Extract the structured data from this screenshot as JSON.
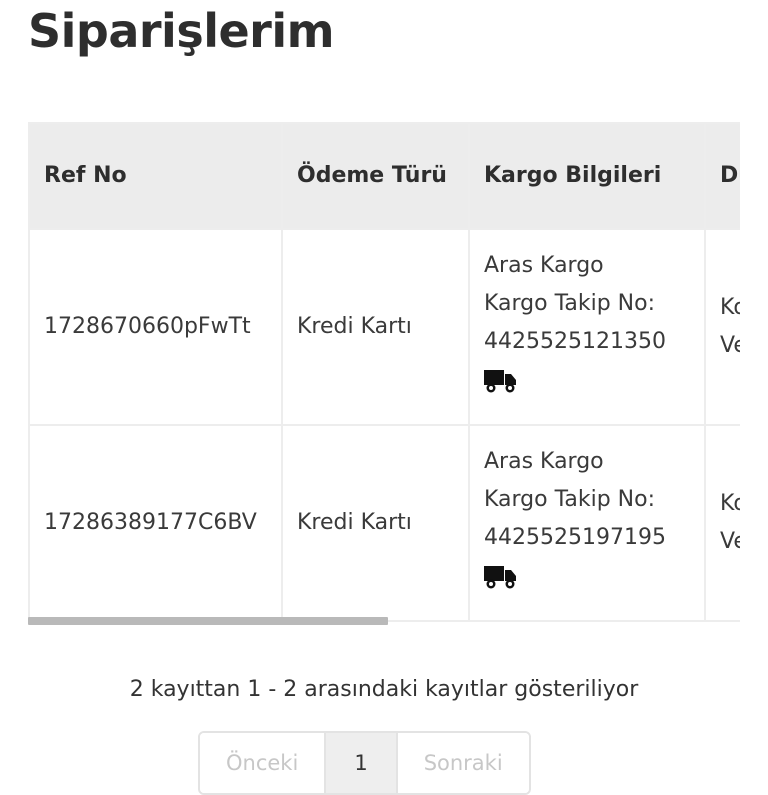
{
  "page": {
    "title": "Siparişlerim"
  },
  "table": {
    "headers": [
      "Ref No",
      "Ödeme Türü",
      "Kargo Bilgileri",
      "Du"
    ],
    "rows": [
      {
        "ref": "1728670660pFwTt",
        "payment": "Kredi Kartı",
        "cargo_company": "Aras Kargo",
        "tracking_label": "Kargo Takip No:",
        "tracking_no": "4425525121350",
        "status": [
          "Ko",
          "Ve"
        ]
      },
      {
        "ref": "17286389177C6BV",
        "payment": "Kredi Kartı",
        "cargo_company": "Aras Kargo",
        "tracking_label": "Kargo Takip No:",
        "tracking_no": "4425525197195",
        "status": [
          "Ko",
          "Ve"
        ]
      }
    ]
  },
  "info": {
    "text": "2 kayıttan 1 - 2 arasındaki kayıtlar gösteriliyor"
  },
  "pagination": {
    "prev": "Önceki",
    "page": "1",
    "next": "Sonraki"
  },
  "icons": {
    "cargo": "truck-icon"
  }
}
